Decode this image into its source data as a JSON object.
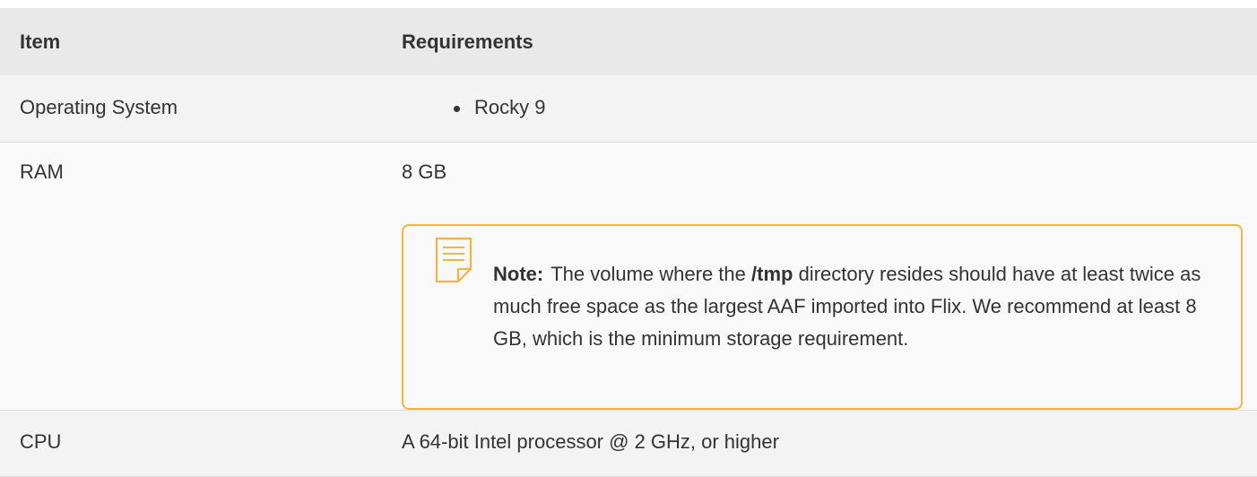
{
  "table": {
    "headers": {
      "item": "Item",
      "requirements": "Requirements"
    },
    "rows": {
      "os": {
        "item": "Operating System",
        "bullets": [
          "Rocky 9"
        ]
      },
      "ram": {
        "item": "RAM",
        "value": "8 GB",
        "note": {
          "icon": "note-icon",
          "label": "Note:",
          "text_before": "The volume where the ",
          "path": "/tmp",
          "text_after": " directory resides should have at least twice as much free space as the largest AAF imported into Flix. We recommend at least 8 GB, which is the minimum storage requirement."
        }
      },
      "cpu": {
        "item": "CPU",
        "value": "A 64-bit Intel processor @ 2 GHz, or higher"
      }
    }
  },
  "colors": {
    "header_bg": "#e9e9e9",
    "row_bg": "#f3f3f3",
    "note_border": "#f2b544",
    "text": "#333333"
  }
}
